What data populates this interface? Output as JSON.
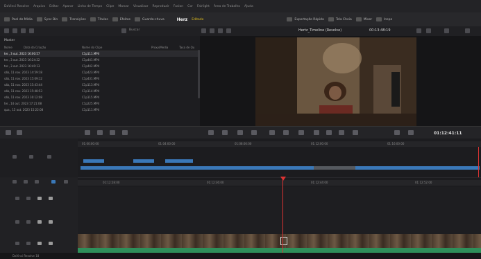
{
  "menu": {
    "items": [
      "DaVinci Resolve",
      "Arquivo",
      "Editar",
      "Aparar",
      "Linha de Tempo",
      "Clipe",
      "Marcar",
      "Visualizar",
      "Reproduzir",
      "Fusion",
      "Cor",
      "Fairlight",
      "Área de Trabalho",
      "Ajuda"
    ]
  },
  "toolbar": {
    "media_pool": "Pool de Mídia",
    "sync_bin": "Sync Bin",
    "transitions": "Transições",
    "titles": "Títulos",
    "effects": "Efeitos",
    "timeline_sel": "Guarda-chuva",
    "project_name": "Herz",
    "edited_label": "Editado",
    "quick_export": "Exportação Rápida",
    "fullscreen": "Tela Cheia",
    "mixer": "Mixer",
    "inspector": "Inspe"
  },
  "subbar": {
    "timeline_name": "Hertz_Timeline (Resolve)",
    "zoom": "",
    "timecode_src": "00:13:48:19",
    "search_label": "Buscar"
  },
  "media_pool": {
    "header": "Master",
    "columns": [
      "Nome",
      "Data da Criação",
      "Nome do Clipe",
      "Proxy/Media",
      "Taxa de Qu"
    ],
    "rows": [
      {
        "date": "ter., 3 out. 2023 16:00:57",
        "name": "C1p111.MP4",
        "selected": true
      },
      {
        "date": "ter., 3 out. 2023 16:24:22",
        "name": "C1p441.MP4",
        "selected": false
      },
      {
        "date": "ter., 3 out. 2023 16:40:13",
        "name": "C1p442.MP4",
        "selected": false
      },
      {
        "date": "sáb, 11 nov. 2023 14:59:18",
        "name": "C1p423.MP4",
        "selected": false
      },
      {
        "date": "sáb, 11 nov. 2023 15:09:12",
        "name": "C1p431.MP4",
        "selected": false
      },
      {
        "date": "sáb, 11 nov. 2023 15:43:44",
        "name": "C1p113.MP4",
        "selected": false
      },
      {
        "date": "sáb, 11 nov. 2023 15:48:53",
        "name": "C1p114.MP4",
        "selected": false
      },
      {
        "date": "sáb, 11 nov. 2023 16:12:08",
        "name": "C1p115.MP4",
        "selected": false
      },
      {
        "date": "ter., 14 out. 2023 17:21:08",
        "name": "C1p225.MP4",
        "selected": false
      },
      {
        "date": "qua., 15 out. 2023 15:22:08",
        "name": "C1p111.MP4",
        "selected": false
      }
    ]
  },
  "viewer": {
    "timecode": "01:12:41:11"
  },
  "timeline": {
    "ruler_top": [
      "01:00:00:00",
      "01:04:00:00",
      "01:08:00:00",
      "01:12:00:00",
      "01:16:00:00"
    ],
    "ruler_main": [
      "01:12:28:00",
      "01:12:36:00",
      "01:12:44:00",
      "01:12:52:00"
    ],
    "tracks": [
      "V3",
      "V2",
      "V1",
      "A1"
    ]
  },
  "status": {
    "app": "DaVinci Resolve 18"
  },
  "colors": {
    "accent": "#e3c01e",
    "clip_blue": "#3a78b8",
    "audio_green": "#2e8f5a",
    "playhead": "#dd3333"
  }
}
